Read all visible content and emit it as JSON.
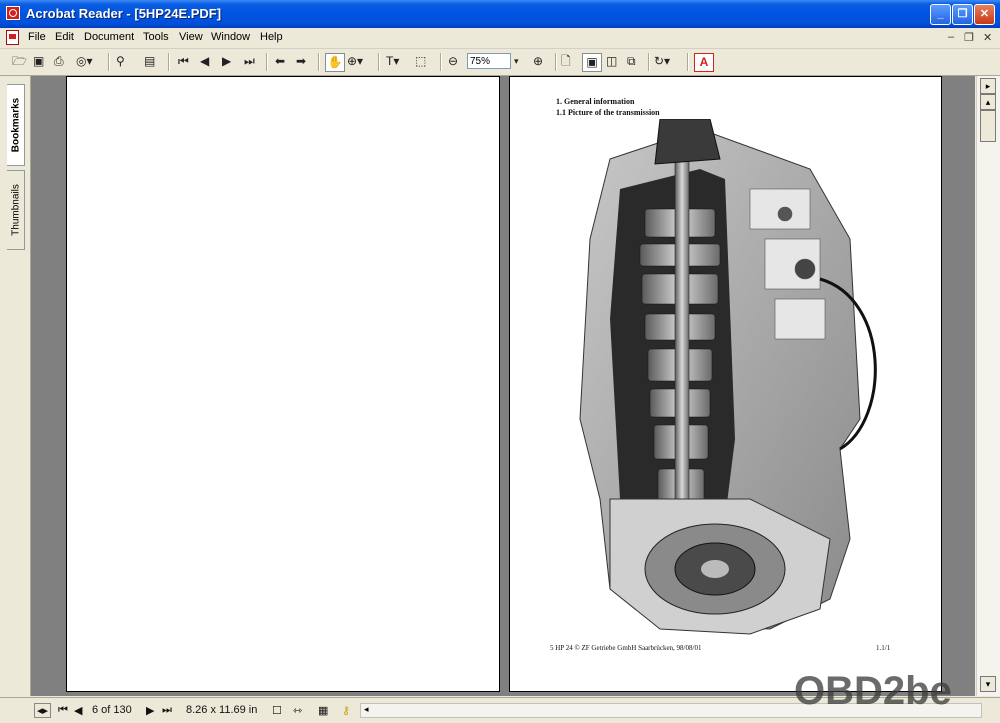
{
  "window": {
    "title": "Acrobat Reader - [5HP24E.PDF]"
  },
  "menu": {
    "items": [
      "File",
      "Edit",
      "Document",
      "Tools",
      "View",
      "Window",
      "Help"
    ]
  },
  "toolbar": {
    "zoom": "75%"
  },
  "sidebar": {
    "tabs": [
      "Bookmarks",
      "Thumbnails"
    ]
  },
  "document": {
    "heading1": "1.    General information",
    "heading2": "1.1   Picture of the transmission",
    "footer_left": "5 HP 24 © ZF Getriebe GmbH Saarbrücken, 98/08/01",
    "footer_right": "1.1/1"
  },
  "status": {
    "page": "6 of 130",
    "size": "8.26 x 11.69 in"
  },
  "watermark": {
    "text": "OBD2be"
  }
}
